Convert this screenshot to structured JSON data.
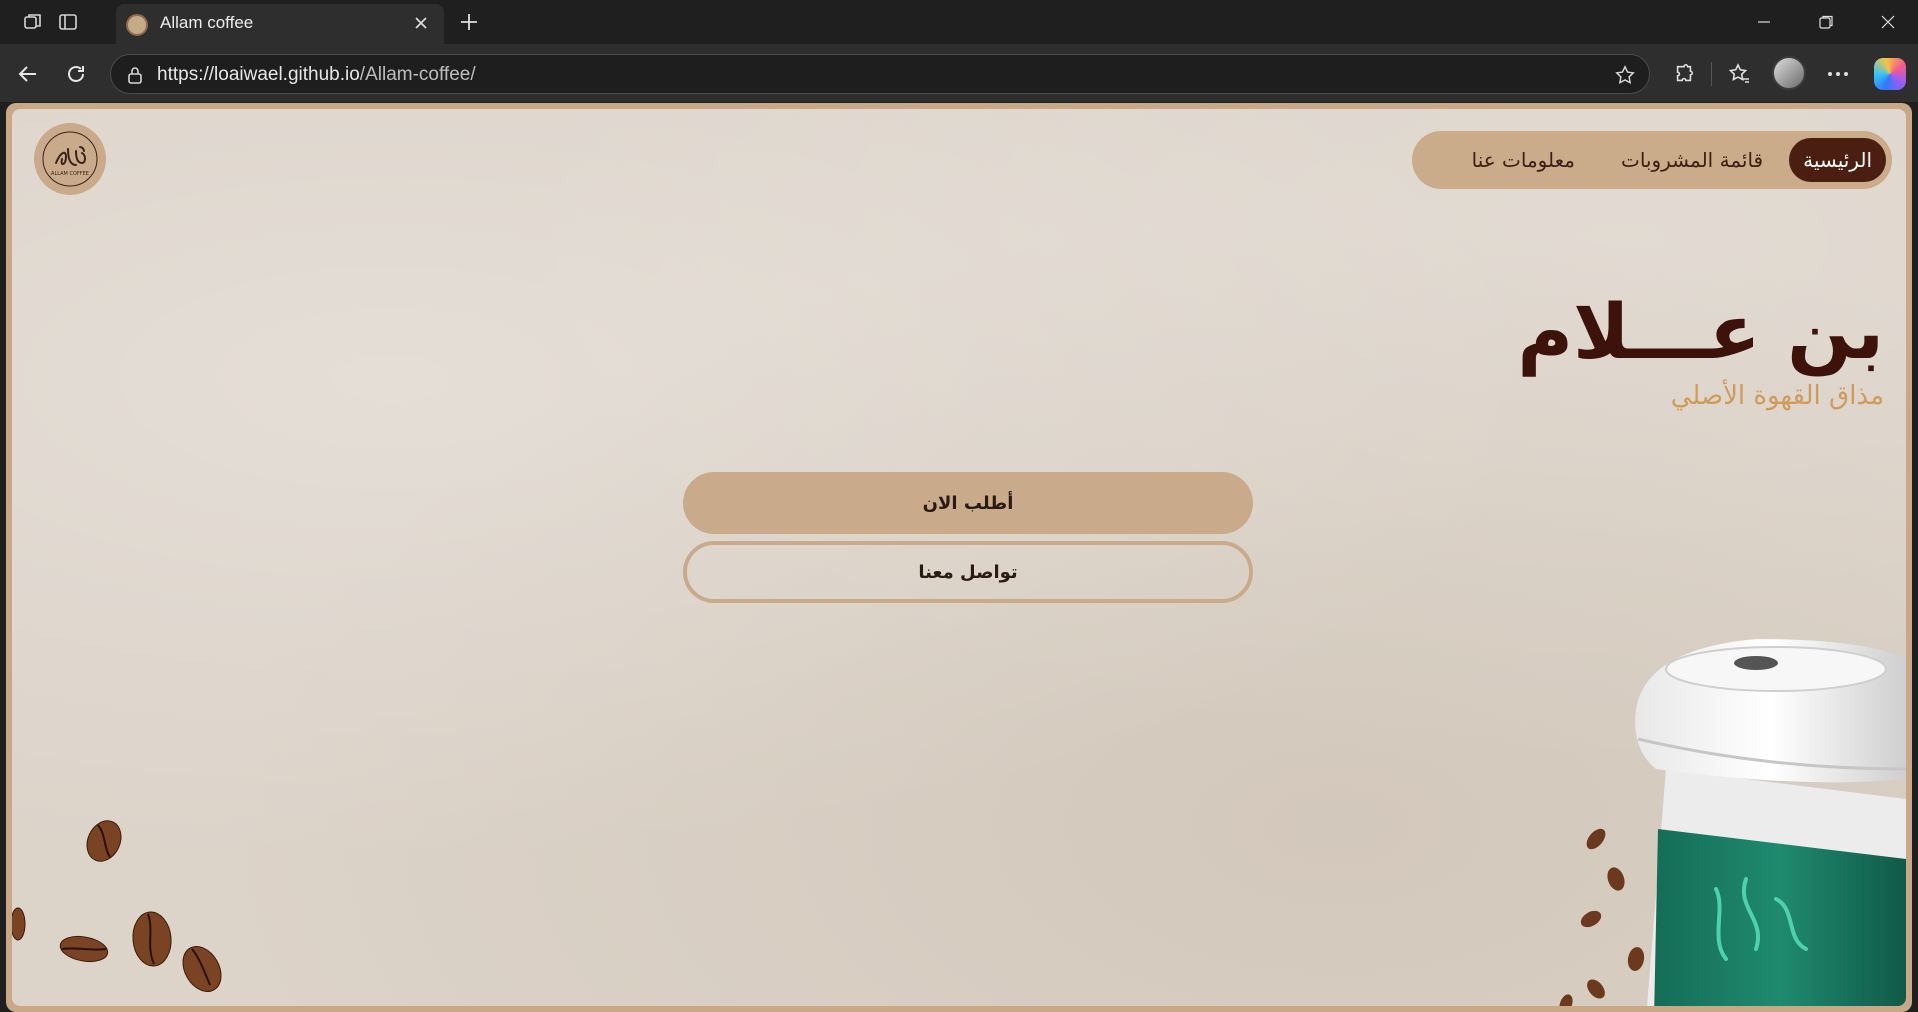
{
  "browser": {
    "tab_title": "Allam coffee",
    "url_host": "https://loaiwael.github.io",
    "url_path": "/Allam-coffee/"
  },
  "site": {
    "nav": [
      {
        "label": "الرئيسية",
        "active": true
      },
      {
        "label": "قائمة المشروبات",
        "active": false
      },
      {
        "label": "معلومات عنا",
        "active": false
      }
    ],
    "hero_title": "بن عـــلام",
    "hero_subtitle": "مذاق القهوة الأصلي",
    "order_button": "أطلب الان",
    "contact_button": "تواصل معنا",
    "logo_text": "ALLAM COFFEE"
  },
  "colors": {
    "accent": "#c9ab8b",
    "dark_brown": "#4a1e10",
    "title": "#3d120a",
    "subtitle": "#cf9b5a",
    "cup_band": "#1f8a6e"
  },
  "icons": [
    "workspaces-icon",
    "tab-actions-icon",
    "close-icon",
    "plus-icon",
    "minimize-icon",
    "restore-icon",
    "back-icon",
    "refresh-icon",
    "lock-icon",
    "star-icon",
    "extensions-icon",
    "favorites-icon",
    "more-icon",
    "copilot-icon"
  ]
}
